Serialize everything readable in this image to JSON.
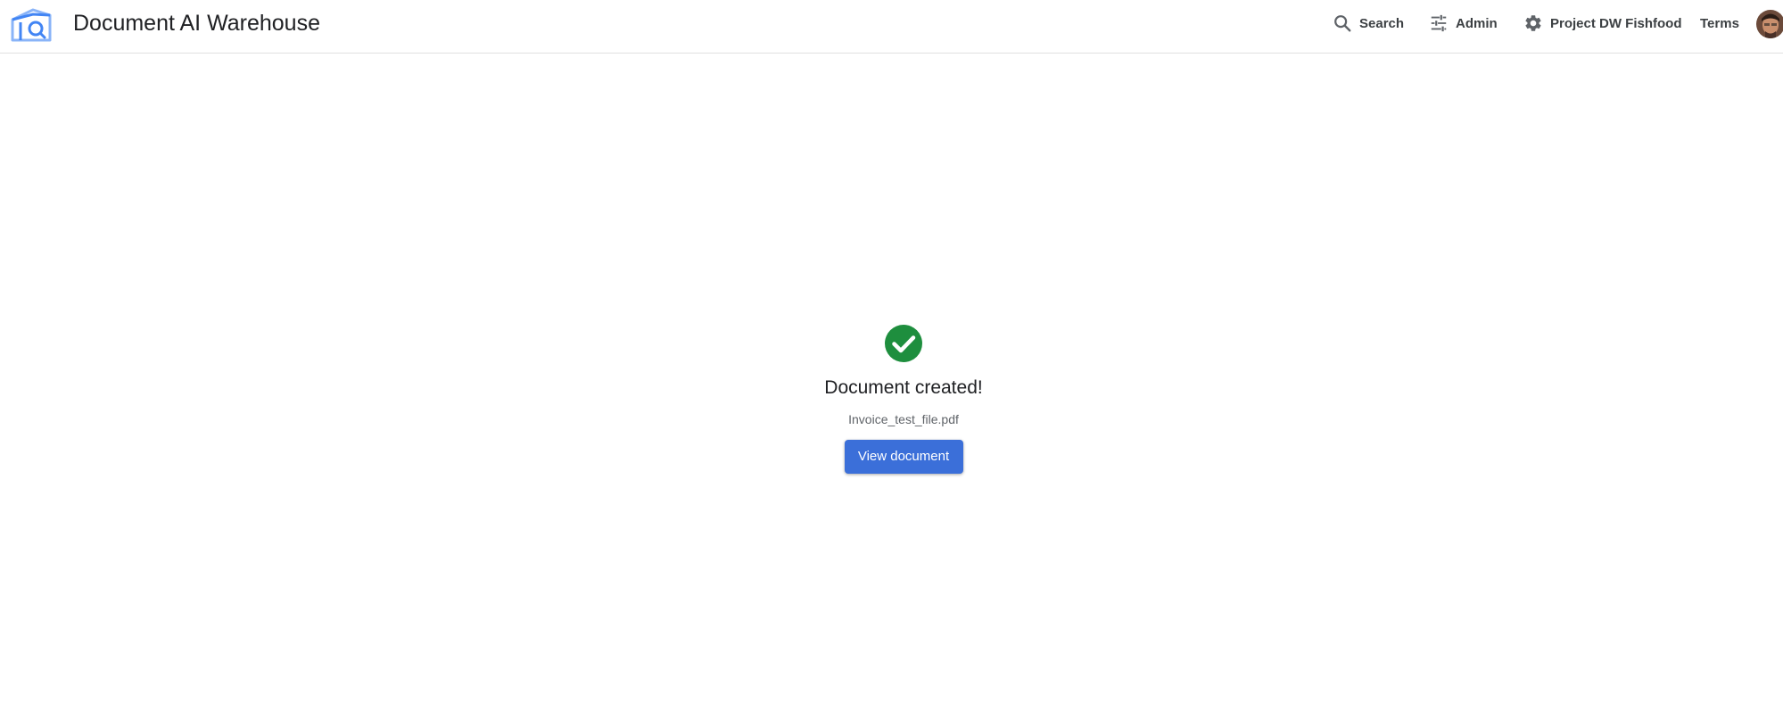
{
  "header": {
    "app_title": "Document AI Warehouse",
    "logo_icon": "document-ai-warehouse-logo",
    "nav": {
      "search": {
        "label": "Search",
        "icon": "search-icon"
      },
      "admin": {
        "label": "Admin",
        "icon": "tune-sliders-icon"
      },
      "project": {
        "label": "Project DW Fishfood",
        "icon": "gear-icon"
      },
      "terms": {
        "label": "Terms"
      }
    },
    "avatar_icon": "user-avatar"
  },
  "main": {
    "status_icon": "check-circle-icon",
    "heading": "Document created!",
    "filename": "Invoice_test_file.pdf",
    "view_button_label": "View document"
  },
  "colors": {
    "accent": "#3b6fd9",
    "success": "#1e8e3e",
    "logo": "#4285f4",
    "text": "#202124",
    "muted_text": "#5f6368"
  }
}
